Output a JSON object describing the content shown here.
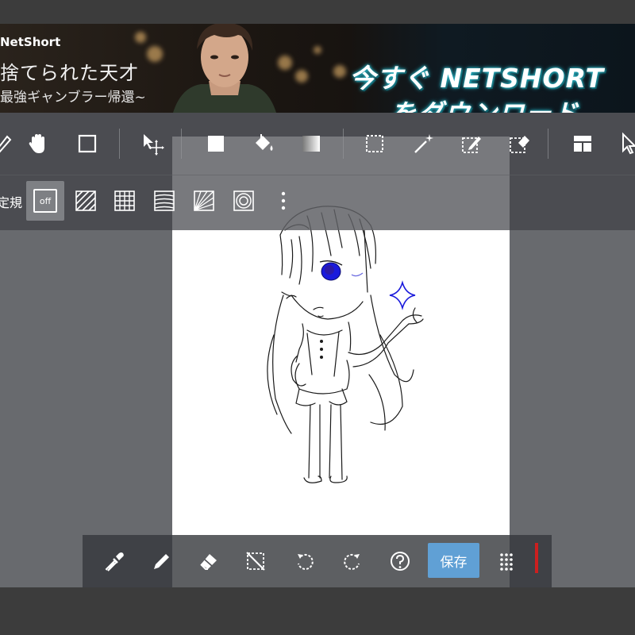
{
  "ad": {
    "brand": "NetShort",
    "title": "捨てられた天才",
    "subtitle": "最強ギャンブラー帰還~",
    "cta_line1": "今すぐ NETSHORT",
    "cta_line2": "をダウンロード"
  },
  "main_toolbar": {
    "tools": [
      "pen-icon",
      "hand-icon",
      "rectangle-icon",
      "move-icon",
      "fill-rect-icon",
      "bucket-icon",
      "gradient-icon",
      "selection-icon",
      "magic-wand-icon",
      "select-pen-icon",
      "select-eraser-icon",
      "layout-icon",
      "pointer-icon"
    ]
  },
  "sub_toolbar": {
    "snap_label": "定規",
    "snap_off_label": "off",
    "snap_modes": [
      "parallel-snap-icon",
      "grid-snap-icon",
      "curve-snap-icon",
      "radial-snap-icon",
      "circle-snap-icon",
      "more-icon"
    ]
  },
  "bottom_toolbar": {
    "tools": [
      "eyedropper-icon",
      "pencil-icon",
      "eraser-icon",
      "deselect-icon",
      "undo-icon",
      "redo-icon",
      "help-icon"
    ],
    "save_label": "保存",
    "grid_icon": "grid-icon",
    "current_color": "#cc1f1f"
  },
  "colors": {
    "accent": "#4f96d1",
    "workspace": "#686a6e",
    "toolbar": "#44464a",
    "drawing_blue": "#1a1adc"
  }
}
